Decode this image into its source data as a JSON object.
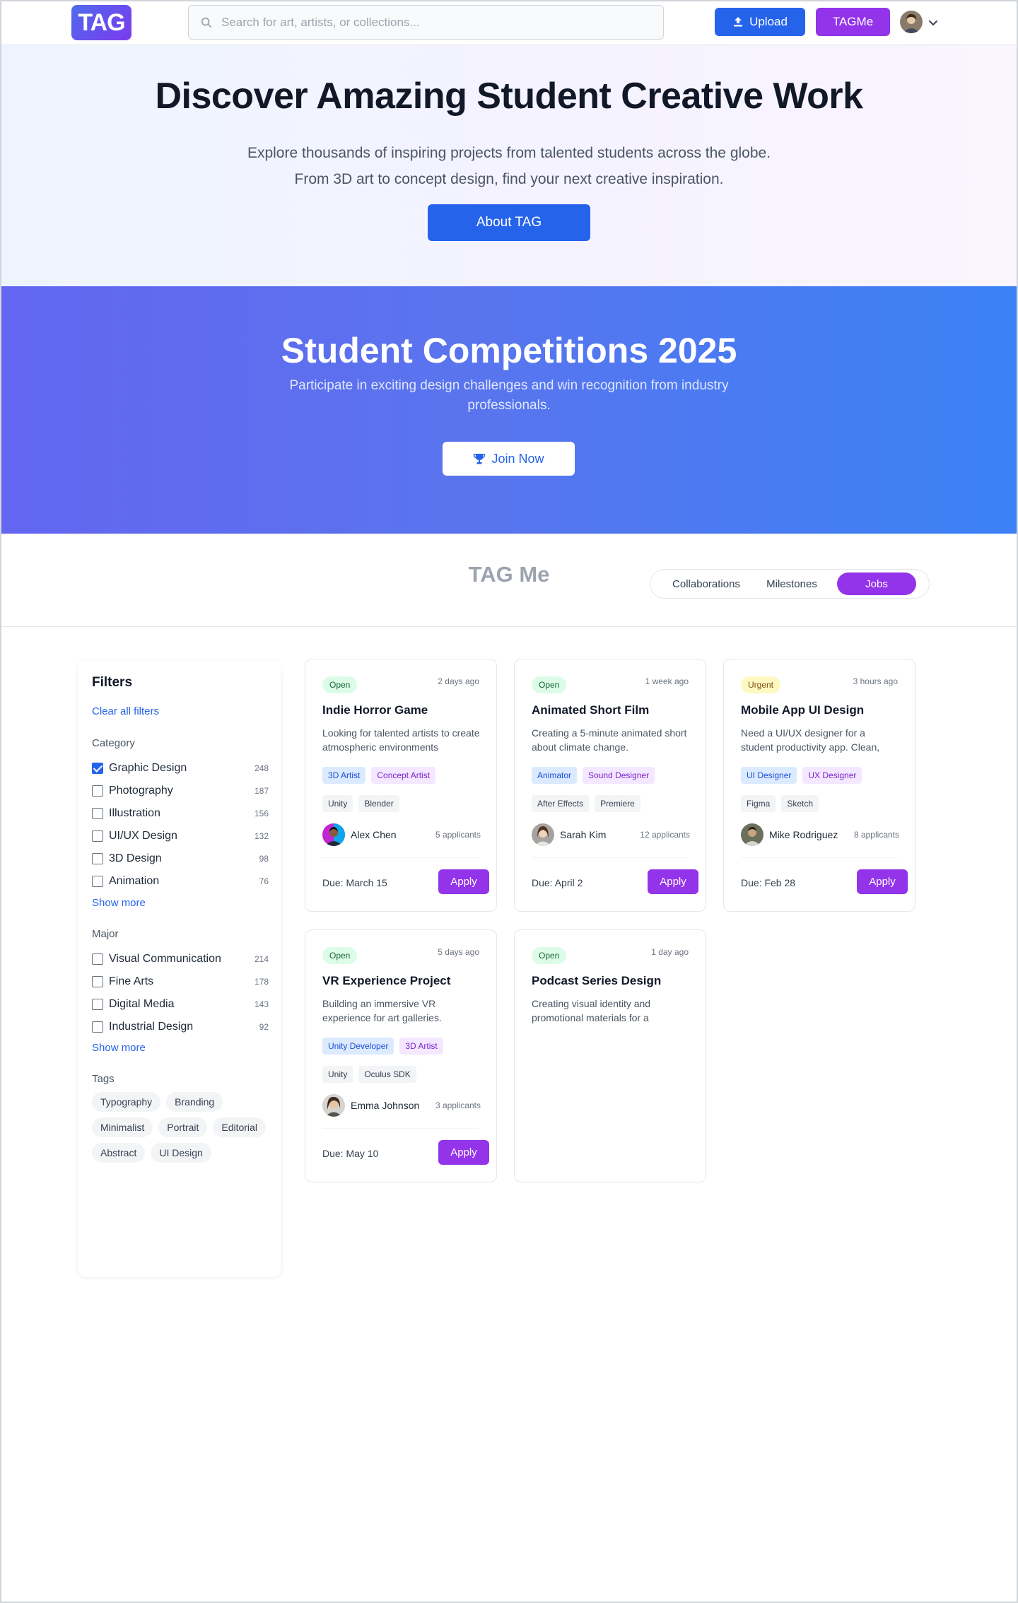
{
  "nav": {
    "logo": "TAG",
    "search_placeholder": "Search for art, artists, or collections...",
    "upload_label": "Upload",
    "tagme_label": "TAGMe"
  },
  "hero": {
    "title": "Discover Amazing Student Creative Work",
    "subtitle_line1": "Explore thousands of inspiring projects from talented students across the globe.",
    "subtitle_line2": "From 3D art to concept design, find your next creative inspiration.",
    "button": "About TAG"
  },
  "competitions": {
    "title": "Student Competitions 2025",
    "subtitle": "Participate in exciting design challenges and win recognition from industry professionals.",
    "button": "Join Now"
  },
  "tagme": {
    "title": "TAG Me",
    "tabs": [
      {
        "label": "Collaborations",
        "active": false
      },
      {
        "label": "Milestones",
        "active": false
      },
      {
        "label": "Jobs",
        "active": true
      }
    ]
  },
  "filters": {
    "title": "Filters",
    "clear": "Clear all filters",
    "category_label": "Category",
    "categories": [
      {
        "label": "Graphic Design",
        "count": "248",
        "checked": true
      },
      {
        "label": "Photography",
        "count": "187",
        "checked": false
      },
      {
        "label": "Illustration",
        "count": "156",
        "checked": false
      },
      {
        "label": "UI/UX Design",
        "count": "132",
        "checked": false
      },
      {
        "label": "3D Design",
        "count": "98",
        "checked": false
      },
      {
        "label": "Animation",
        "count": "76",
        "checked": false
      }
    ],
    "show_more_1": "Show more",
    "major_label": "Major",
    "majors": [
      {
        "label": "Visual Communication",
        "count": "214",
        "checked": false
      },
      {
        "label": "Fine Arts",
        "count": "178",
        "checked": false
      },
      {
        "label": "Digital Media",
        "count": "143",
        "checked": false
      },
      {
        "label": "Industrial Design",
        "count": "92",
        "checked": false
      }
    ],
    "show_more_2": "Show more",
    "tags_label": "Tags",
    "tags": [
      "Typography",
      "Branding",
      "Minimalist",
      "Portrait",
      "Editorial",
      "Abstract",
      "UI Design"
    ]
  },
  "jobs": [
    {
      "status": "Open",
      "status_type": "open",
      "posted": "2 days ago",
      "title": "Indie Horror Game",
      "description": "Looking for talented artists to create atmospheric environments",
      "roles": [
        {
          "label": "3D Artist",
          "color": "blue"
        },
        {
          "label": "Concept Artist",
          "color": "purple"
        }
      ],
      "tools": [
        "Unity",
        "Blender"
      ],
      "poster": "Alex Chen",
      "applicants": "5 applicants",
      "due": "Due: March 15",
      "apply": "Apply"
    },
    {
      "status": "Open",
      "status_type": "open",
      "posted": "1 week ago",
      "title": "Animated Short Film",
      "description": "Creating a 5-minute animated short about climate change.",
      "roles": [
        {
          "label": "Animator",
          "color": "blue"
        },
        {
          "label": "Sound Designer",
          "color": "purple"
        }
      ],
      "tools": [
        "After Effects",
        "Premiere"
      ],
      "poster": "Sarah Kim",
      "applicants": "12 applicants",
      "due": "Due: April 2",
      "apply": "Apply"
    },
    {
      "status": "Urgent",
      "status_type": "urgent",
      "posted": "3 hours ago",
      "title": "Mobile App UI Design",
      "description": "Need a UI/UX designer for a student productivity app. Clean,",
      "roles": [
        {
          "label": "UI Designer",
          "color": "blue"
        },
        {
          "label": "UX Designer",
          "color": "purple"
        }
      ],
      "tools": [
        "Figma",
        "Sketch"
      ],
      "poster": "Mike Rodriguez",
      "applicants": "8 applicants",
      "due": "Due: Feb 28",
      "apply": "Apply"
    },
    {
      "status": "Open",
      "status_type": "open",
      "posted": "5 days ago",
      "title": "VR Experience Project",
      "description": "Building an immersive VR experience for art galleries.",
      "roles": [
        {
          "label": "Unity Developer",
          "color": "blue"
        },
        {
          "label": "3D Artist",
          "color": "purple"
        }
      ],
      "tools": [
        "Unity",
        "Oculus SDK"
      ],
      "poster": "Emma Johnson",
      "applicants": "3 applicants",
      "due": "Due: May 10",
      "apply": "Apply"
    },
    {
      "status": "Open",
      "status_type": "open",
      "posted": "1 day ago",
      "title": "Podcast Series Design",
      "description": "Creating visual identity and promotional materials for a",
      "roles": [],
      "tools": [],
      "poster": "",
      "applicants": "",
      "due": "",
      "apply": ""
    }
  ],
  "colors": {
    "primary_blue": "#2563eb",
    "primary_purple": "#9333ea",
    "open_badge": "#dcfce7",
    "urgent_badge": "#fef9c3"
  }
}
